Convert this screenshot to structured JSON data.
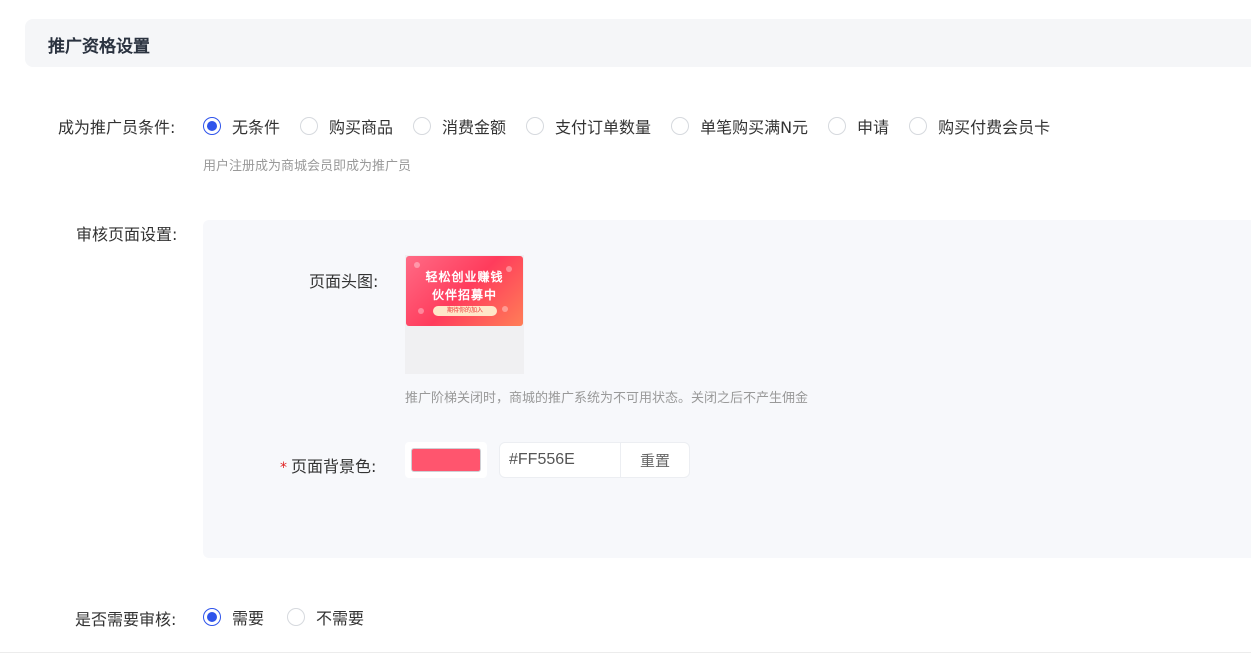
{
  "section": {
    "title": "推广资格设置"
  },
  "condition": {
    "label": "成为推广员条件:",
    "options": [
      "无条件",
      "购买商品",
      "消费金额",
      "支付订单数量",
      "单笔购买满N元",
      "申请",
      "购买付费会员卡"
    ],
    "selected_index": 0,
    "hint": "用户注册成为商城会员即成为推广员"
  },
  "review_page": {
    "label": "审核页面设置:",
    "header_image": {
      "label": "页面头图:",
      "banner_line1": "轻松创业赚钱",
      "banner_line2": "伙伴招募中",
      "banner_button": "期待你的加入",
      "hint": "推广阶梯关闭时，商城的推广系统为不可用状态。关闭之后不产生佣金"
    },
    "bg_color": {
      "required_mark": "*",
      "label": "页面背景色:",
      "value": "#FF556E",
      "swatch_color": "#FF556E",
      "reset_label": "重置"
    }
  },
  "need_review": {
    "label": "是否需要审核:",
    "options": [
      "需要",
      "不需要"
    ],
    "selected_index": 0
  },
  "colors": {
    "accent": "#2F54EB",
    "required": "#E02020"
  }
}
